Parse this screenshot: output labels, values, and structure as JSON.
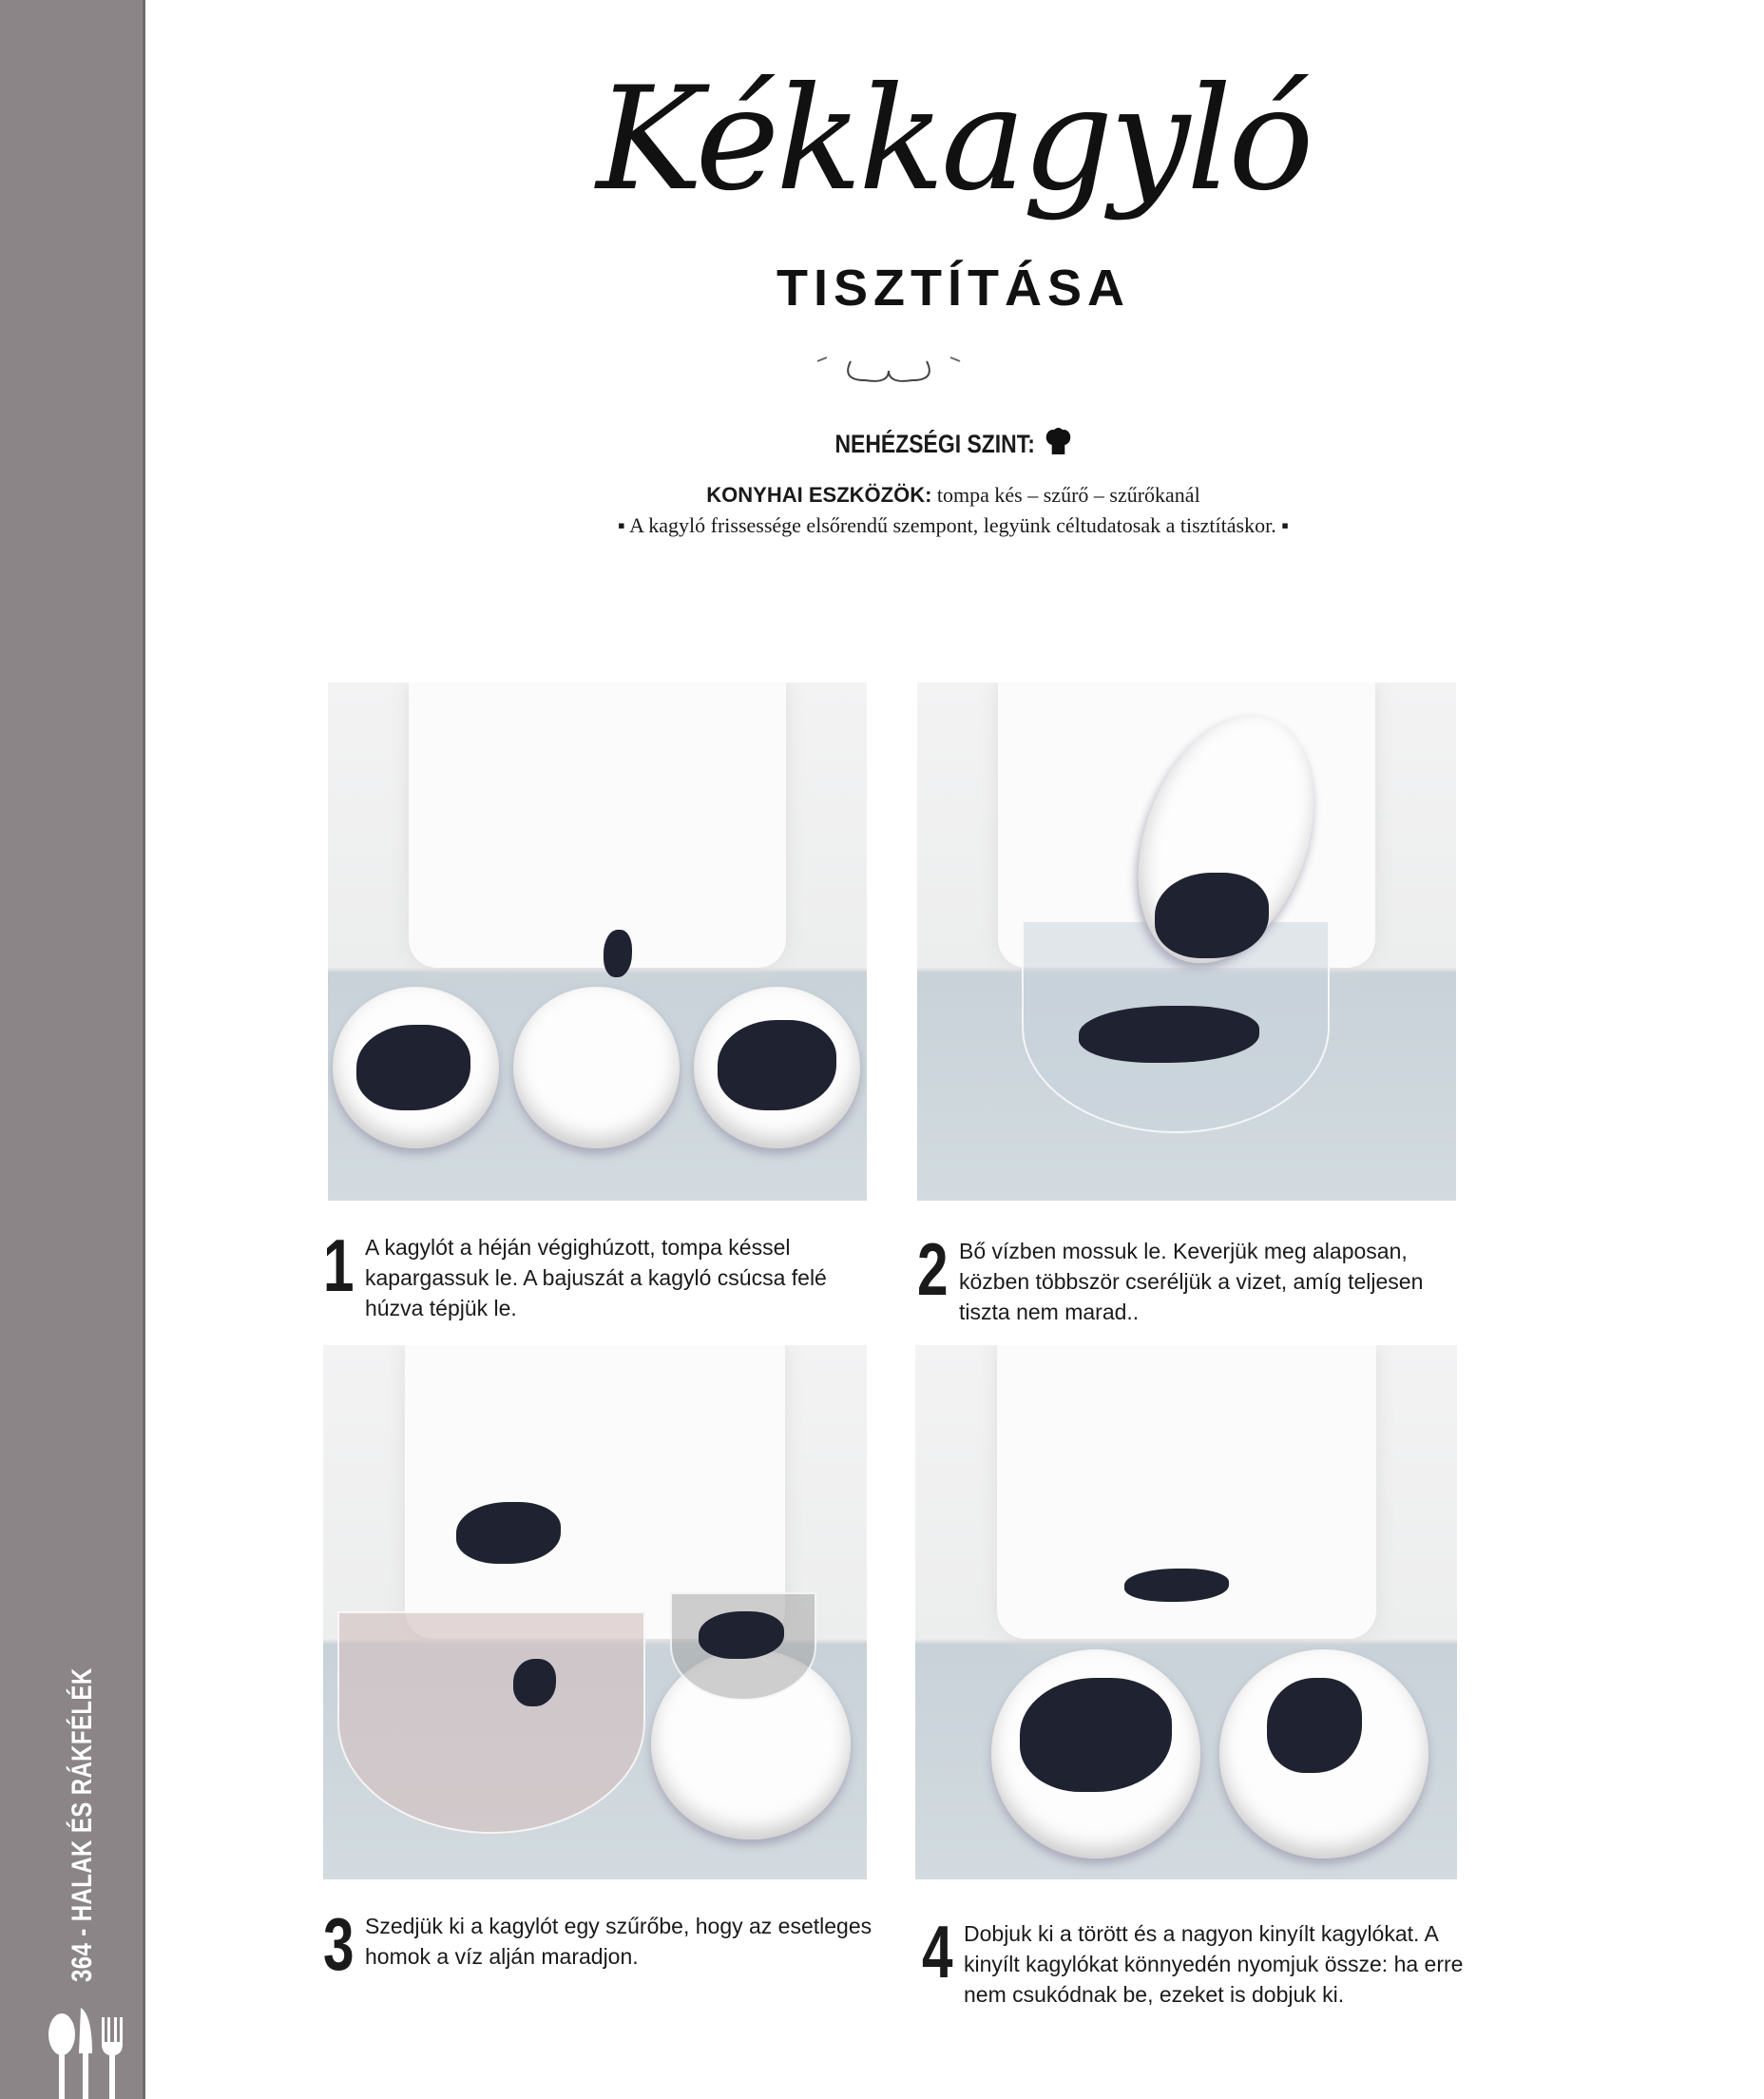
{
  "sidebar": {
    "label": "364 - HALAK ÉS RÁKFÉLÉK",
    "icon": "cutlery-icon",
    "color": "#8b8588"
  },
  "header": {
    "title": "Kékkagyló",
    "subtitle": "TISZTÍTÁSA"
  },
  "difficulty": {
    "label": "NEHÉZSÉGI SZINT:",
    "level": 1,
    "icon": "chef-hat-icon"
  },
  "tools": {
    "label": "KONYHAI ESZKÖZÖK:",
    "value": "tompa kés – szűrő – szűrőkanál"
  },
  "note": "▪ A kagyló frissessége elsőrendű szempont, legyünk céltudatosak a tisztításkor. ▪",
  "steps": [
    {
      "number": "1",
      "text": "A kagylót a héján végighúzott, tompa késsel kapargassuk le. A bajuszát a kagyló csúcsa felé húzva tépjük le."
    },
    {
      "number": "2",
      "text": "Bő vízben mossuk le. Keverjük meg alaposan, közben többször cseréljük a vizet, amíg teljesen tiszta nem marad.."
    },
    {
      "number": "3",
      "text": "Szedjük ki a kagylót egy szűrőbe, hogy az esetleges homok a víz alján maradjon."
    },
    {
      "number": "4",
      "text": "Dobjuk ki a törött és a nagyon kinyílt kagylókat. A kinyílt kagylókat könnyedén nyomjuk össze: ha erre nem csukódnak be, ezeket is dobjuk ki."
    }
  ]
}
